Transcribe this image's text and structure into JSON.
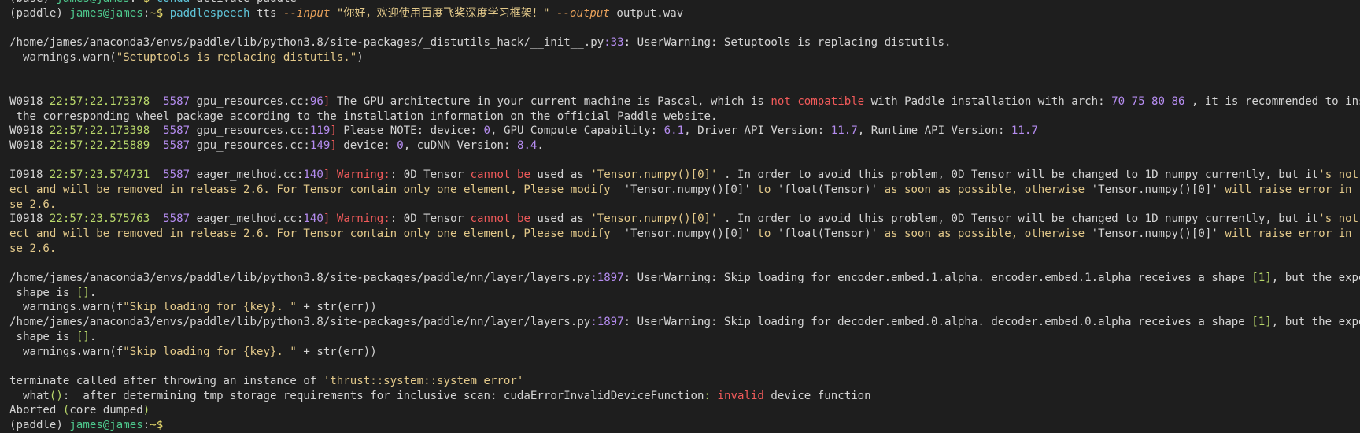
{
  "terminal": {
    "background": "#1e1e1e",
    "lines": [
      [
        {
          "t": "(base) ",
          "c": "default"
        },
        {
          "t": "james@james",
          "c": "user"
        },
        {
          "t": ":",
          "c": "default"
        },
        {
          "t": "~$ ",
          "c": "prompt"
        },
        {
          "t": "conda",
          "c": "cmd"
        },
        {
          "t": " activate paddle",
          "c": "default"
        }
      ],
      [
        {
          "t": "(paddle) ",
          "c": "default"
        },
        {
          "t": "james@james",
          "c": "user"
        },
        {
          "t": ":",
          "c": "default"
        },
        {
          "t": "~$ ",
          "c": "prompt"
        },
        {
          "t": "paddlespeech",
          "c": "cmd"
        },
        {
          "t": " tts ",
          "c": "default"
        },
        {
          "t": "--input",
          "c": "flag"
        },
        {
          "t": " \"你好，欢迎使用百度飞桨深度学习框架！\" ",
          "c": "string"
        },
        {
          "t": "--output",
          "c": "flag"
        },
        {
          "t": " output.wav",
          "c": "default"
        }
      ],
      [],
      [
        {
          "t": "/home/james/anaconda3/envs/paddle/lib/python3.8/site-packages/_distutils_hack/__init__.py",
          "c": "default"
        },
        {
          "t": ":33",
          "c": "number"
        },
        {
          "t": ": UserWarning: Setuptools is replacing distutils.",
          "c": "default"
        }
      ],
      [
        {
          "t": "  warnings.warn(",
          "c": "default"
        },
        {
          "t": "\"Setuptools is replacing distutils.\"",
          "c": "string"
        },
        {
          "t": ")",
          "c": "default"
        }
      ],
      [],
      [],
      [
        {
          "t": "W0918 ",
          "c": "default"
        },
        {
          "t": "22:57:22.173378",
          "c": "time"
        },
        {
          "t": "  5587",
          "c": "pid"
        },
        {
          "t": " gpu_resources.cc:",
          "c": "default"
        },
        {
          "t": "96",
          "c": "number"
        },
        {
          "t": "]",
          "c": "bracket"
        },
        {
          "t": " The GPU architecture in your current machine is Pascal, which is ",
          "c": "default"
        },
        {
          "t": "not compatible",
          "c": "red"
        },
        {
          "t": " with Paddle installation with arch: ",
          "c": "default"
        },
        {
          "t": "70 75 80 86",
          "c": "number"
        },
        {
          "t": " , it is recommended to install",
          "c": "default"
        }
      ],
      [
        {
          "t": " the corresponding wheel package according to the installation information on the official Paddle website.",
          "c": "default"
        }
      ],
      [
        {
          "t": "W0918 ",
          "c": "default"
        },
        {
          "t": "22:57:22.173398",
          "c": "time"
        },
        {
          "t": "  5587",
          "c": "pid"
        },
        {
          "t": " gpu_resources.cc:",
          "c": "default"
        },
        {
          "t": "119",
          "c": "number"
        },
        {
          "t": "]",
          "c": "bracket"
        },
        {
          "t": " Please NOTE: device: ",
          "c": "default"
        },
        {
          "t": "0",
          "c": "number"
        },
        {
          "t": ", GPU Compute Capability: ",
          "c": "default"
        },
        {
          "t": "6.1",
          "c": "number"
        },
        {
          "t": ", Driver API Version: ",
          "c": "default"
        },
        {
          "t": "11.7",
          "c": "number"
        },
        {
          "t": ", Runtime API Version: ",
          "c": "default"
        },
        {
          "t": "11.7",
          "c": "number"
        }
      ],
      [
        {
          "t": "W0918 ",
          "c": "default"
        },
        {
          "t": "22:57:22.215889",
          "c": "time"
        },
        {
          "t": "  5587",
          "c": "pid"
        },
        {
          "t": " gpu_resources.cc:",
          "c": "default"
        },
        {
          "t": "149",
          "c": "number"
        },
        {
          "t": "]",
          "c": "bracket"
        },
        {
          "t": " device: ",
          "c": "default"
        },
        {
          "t": "0",
          "c": "number"
        },
        {
          "t": ", cuDNN Version: ",
          "c": "default"
        },
        {
          "t": "8.4",
          "c": "number"
        },
        {
          "t": ".",
          "c": "default"
        }
      ],
      [],
      [
        {
          "t": "I0918 ",
          "c": "default"
        },
        {
          "t": "22:57:23.574731",
          "c": "time"
        },
        {
          "t": "  5587",
          "c": "pid"
        },
        {
          "t": " eager_method.cc:",
          "c": "default"
        },
        {
          "t": "140",
          "c": "number"
        },
        {
          "t": "]",
          "c": "bracket"
        },
        {
          "t": " ",
          "c": "default"
        },
        {
          "t": "Warning:",
          "c": "red"
        },
        {
          "t": ": 0D Tensor ",
          "c": "default"
        },
        {
          "t": "cannot be",
          "c": "red"
        },
        {
          "t": " used as ",
          "c": "default"
        },
        {
          "t": "'Tensor.numpy()[0]'",
          "c": "string"
        },
        {
          "t": " . In order to avoid this problem, 0D Tensor will be changed to 1D numpy currently, but it",
          "c": "default"
        },
        {
          "t": "'s not corr",
          "c": "warn"
        }
      ],
      [
        {
          "t": "ect and will be removed in release 2.6. For Tensor contain only one element, Please modify  ",
          "c": "warn"
        },
        {
          "t": "'Tensor.numpy()[0]'",
          "c": "default"
        },
        {
          "t": " to ",
          "c": "warn"
        },
        {
          "t": "'float(Tensor)'",
          "c": "default"
        },
        {
          "t": " as soon as possible, otherwise ",
          "c": "warn"
        },
        {
          "t": "'Tensor.numpy()[0]'",
          "c": "default"
        },
        {
          "t": " will raise error in relea",
          "c": "warn"
        }
      ],
      [
        {
          "t": "se 2.6.",
          "c": "warn"
        }
      ],
      [
        {
          "t": "I0918 ",
          "c": "default"
        },
        {
          "t": "22:57:23.575763",
          "c": "time"
        },
        {
          "t": "  5587",
          "c": "pid"
        },
        {
          "t": " eager_method.cc:",
          "c": "default"
        },
        {
          "t": "140",
          "c": "number"
        },
        {
          "t": "]",
          "c": "bracket"
        },
        {
          "t": " ",
          "c": "default"
        },
        {
          "t": "Warning:",
          "c": "red"
        },
        {
          "t": ": 0D Tensor ",
          "c": "default"
        },
        {
          "t": "cannot be",
          "c": "red"
        },
        {
          "t": " used as ",
          "c": "default"
        },
        {
          "t": "'Tensor.numpy()[0]'",
          "c": "string"
        },
        {
          "t": " . In order to avoid this problem, 0D Tensor will be changed to 1D numpy currently, but it",
          "c": "default"
        },
        {
          "t": "'s not corr",
          "c": "warn"
        }
      ],
      [
        {
          "t": "ect and will be removed in release 2.6. For Tensor contain only one element, Please modify  ",
          "c": "warn"
        },
        {
          "t": "'Tensor.numpy()[0]'",
          "c": "default"
        },
        {
          "t": " to ",
          "c": "warn"
        },
        {
          "t": "'float(Tensor)'",
          "c": "default"
        },
        {
          "t": " as soon as possible, otherwise ",
          "c": "warn"
        },
        {
          "t": "'Tensor.numpy()[0]'",
          "c": "default"
        },
        {
          "t": " will raise error in relea",
          "c": "warn"
        }
      ],
      [
        {
          "t": "se 2.6.",
          "c": "warn"
        }
      ],
      [],
      [
        {
          "t": "/home/james/anaconda3/envs/paddle/lib/python3.8/site-packages/paddle/nn/layer/layers.py",
          "c": "default"
        },
        {
          "t": ":1897",
          "c": "number"
        },
        {
          "t": ": UserWarning: Skip loading for encoder.embed.1.alpha. encoder.embed.1.alpha receives a shape ",
          "c": "default"
        },
        {
          "t": "[1]",
          "c": "green"
        },
        {
          "t": ", but the expected",
          "c": "default"
        }
      ],
      [
        {
          "t": " shape is ",
          "c": "default"
        },
        {
          "t": "[]",
          "c": "green"
        },
        {
          "t": ".",
          "c": "default"
        }
      ],
      [
        {
          "t": "  warnings.warn(f",
          "c": "default"
        },
        {
          "t": "\"Skip loading for {key}. \"",
          "c": "string"
        },
        {
          "t": " + str(err))",
          "c": "default"
        }
      ],
      [
        {
          "t": "/home/james/anaconda3/envs/paddle/lib/python3.8/site-packages/paddle/nn/layer/layers.py",
          "c": "default"
        },
        {
          "t": ":1897",
          "c": "number"
        },
        {
          "t": ": UserWarning: Skip loading for decoder.embed.0.alpha. decoder.embed.0.alpha receives a shape ",
          "c": "default"
        },
        {
          "t": "[1]",
          "c": "green"
        },
        {
          "t": ", but the expected",
          "c": "default"
        }
      ],
      [
        {
          "t": " shape is ",
          "c": "default"
        },
        {
          "t": "[]",
          "c": "green"
        },
        {
          "t": ".",
          "c": "default"
        }
      ],
      [
        {
          "t": "  warnings.warn(f",
          "c": "default"
        },
        {
          "t": "\"Skip loading for {key}. \"",
          "c": "string"
        },
        {
          "t": " + str(err))",
          "c": "default"
        }
      ],
      [],
      [
        {
          "t": "terminate called after throwing an instance of ",
          "c": "default"
        },
        {
          "t": "'thrust::system::system_error'",
          "c": "string"
        }
      ],
      [
        {
          "t": "  what",
          "c": "default"
        },
        {
          "t": "()",
          "c": "green"
        },
        {
          "t": ":  after determining tmp storage requirements for inclusive_scan: cudaErrorInvalidDeviceFunction",
          "c": "default"
        },
        {
          "t": ":",
          "c": "green"
        },
        {
          "t": " ",
          "c": "default"
        },
        {
          "t": "invalid",
          "c": "red"
        },
        {
          "t": " device function",
          "c": "default"
        }
      ],
      [
        {
          "t": "Aborted ",
          "c": "default"
        },
        {
          "t": "(",
          "c": "green"
        },
        {
          "t": "core dumped",
          "c": "default"
        },
        {
          "t": ")",
          "c": "green"
        }
      ],
      [
        {
          "t": "(paddle) ",
          "c": "default"
        },
        {
          "t": "james@james",
          "c": "user"
        },
        {
          "t": ":",
          "c": "default"
        },
        {
          "t": "~$",
          "c": "prompt"
        }
      ]
    ]
  }
}
